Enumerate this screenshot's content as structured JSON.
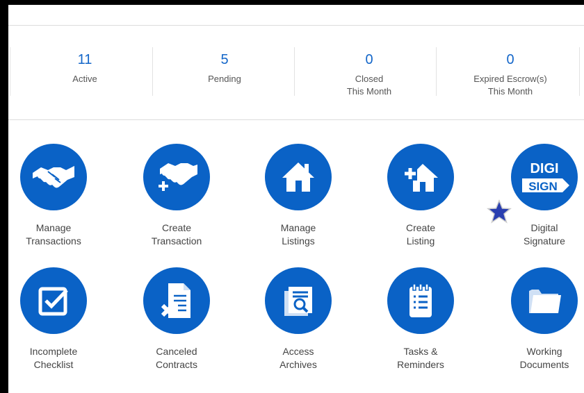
{
  "stats": [
    {
      "value": "11",
      "label": "Active"
    },
    {
      "value": "5",
      "label": "Pending"
    },
    {
      "value": "0",
      "label": "Closed\nThis Month"
    },
    {
      "value": "0",
      "label": "Expired Escrow(s)\nThis Month"
    }
  ],
  "tiles": {
    "manage_transactions": {
      "label": "Manage\nTransactions",
      "icon": "handshake-icon"
    },
    "create_transaction": {
      "label": "Create\nTransaction",
      "icon": "handshake-plus-icon"
    },
    "manage_listings": {
      "label": "Manage\nListings",
      "icon": "house-icon"
    },
    "create_listing": {
      "label": "Create\nListing",
      "icon": "house-plus-icon"
    },
    "digital_signature": {
      "label": "Digital\nSignature",
      "icon": "digisign-icon",
      "logo_top": "DIGI",
      "logo_bottom": "SIGN"
    },
    "incomplete_checklist": {
      "label": "Incomplete\nChecklist",
      "icon": "checkbox-icon"
    },
    "canceled_contracts": {
      "label": "Canceled\nContracts",
      "icon": "document-x-icon"
    },
    "access_archives": {
      "label": "Access\nArchives",
      "icon": "archive-search-icon"
    },
    "tasks_reminders": {
      "label": "Tasks &\nReminders",
      "icon": "clipboard-icon"
    },
    "working_documents": {
      "label": "Working\nDocuments",
      "icon": "folder-icon"
    }
  },
  "colors": {
    "accent": "#0a62c6",
    "stat_number": "#1366c9",
    "star": "#2a3fb0"
  }
}
